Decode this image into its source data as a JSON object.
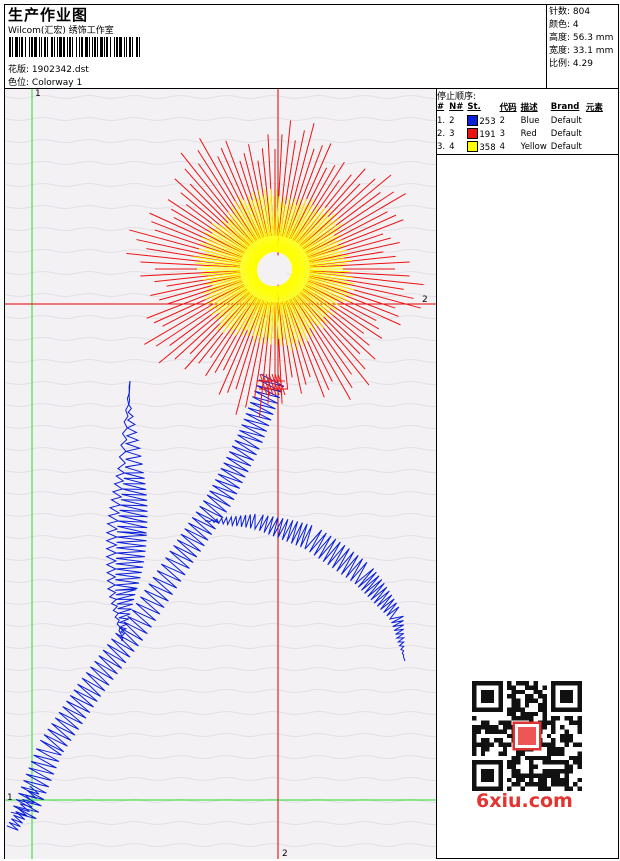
{
  "header": {
    "title": "生产作业图",
    "company": "Wilcom(汇宏) 绣饰工作室",
    "design_label": "花版:",
    "design_value": "1902342.dst",
    "colorway_label": "色位:",
    "colorway_value": "Colorway 1"
  },
  "stats": [
    {
      "label": "针数:",
      "value": "804"
    },
    {
      "label": "颜色:",
      "value": "4"
    },
    {
      "label": "高度:",
      "value": "56.3 mm"
    },
    {
      "label": "宽度:",
      "value": "33.1 mm"
    },
    {
      "label": "比例:",
      "value": "4.29"
    }
  ],
  "stop_sequence": {
    "title": "停止顺序:",
    "columns": [
      "#",
      "N#",
      "St.",
      "代码",
      "描述",
      "Brand",
      "元素"
    ],
    "rows": [
      {
        "idx": "1.",
        "n": "2",
        "color": "#0a1fd8",
        "st": "253",
        "code": "2",
        "desc": "Blue",
        "brand": "Default"
      },
      {
        "idx": "2.",
        "n": "3",
        "color": "#ee1111",
        "st": "191",
        "code": "3",
        "desc": "Red",
        "brand": "Default"
      },
      {
        "idx": "3.",
        "n": "4",
        "color": "#ffff00",
        "st": "358",
        "code": "4",
        "desc": "Yellow",
        "brand": "Default"
      }
    ]
  },
  "guides": {
    "green_v_label": "1",
    "green_h_label": "1",
    "red_h_label": "2",
    "red_v_label": "2"
  },
  "colors": {
    "blue": "#0a1fd8",
    "red": "#ee1111",
    "yellow": "#ffff00",
    "green": "#22dd22",
    "crosshair": "#dd0000"
  },
  "watermark": "6xiu.com"
}
